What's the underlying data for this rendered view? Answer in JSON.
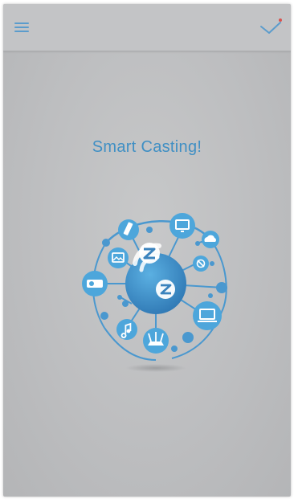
{
  "topbar": {
    "menu_icon": "hamburger-menu-icon",
    "confirm_icon": "checkmark-icon"
  },
  "main": {
    "title": "Smart Casting!",
    "illustration": {
      "center_icon": "zz-cast-logo-icon",
      "device_icons": [
        "tv-icon",
        "cloud-icon",
        "no-signal-icon",
        "laptop-icon",
        "router-icon",
        "music-note-icon",
        "projector-icon",
        "image-icon",
        "usb-drive-icon"
      ]
    }
  },
  "colors": {
    "accent": "#3f8fc4",
    "node_blue": "#4da6db",
    "node_dark": "#3b83bd",
    "background": "#bdbec0"
  }
}
